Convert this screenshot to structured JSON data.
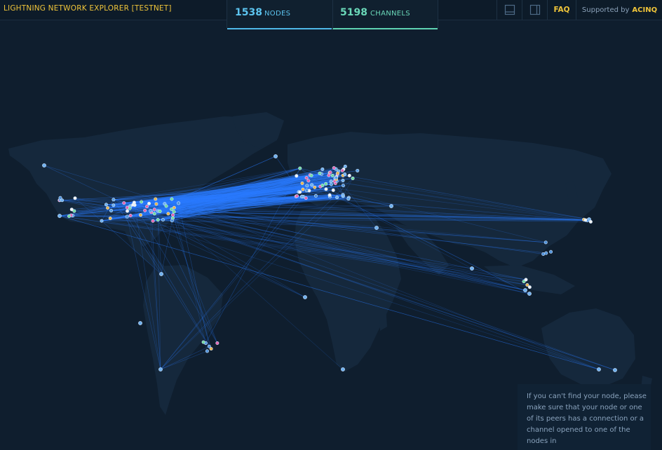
{
  "header": {
    "title": "LIGHTNING NETWORK EXPLORER [TESTNET]",
    "nodes_count": "1538",
    "nodes_label": "NODES",
    "channels_count": "5198",
    "channels_label": "CHANNELS",
    "faq_label": "FAQ",
    "supported_by": "Supported by",
    "sponsor": "ACINQ"
  },
  "info": {
    "text": "If you can't find your node, please make sure that your node or one of its peers has a connection or a channel opened to one of the nodes in"
  },
  "colors": {
    "accent_yellow": "#f0c53a",
    "nodes_blue": "#5cc4ef",
    "channels_green": "#6ad7b8",
    "edge_blue": "#2a7cff",
    "background": "#0f1e2e"
  },
  "icons": [
    "layout-horizontal-icon",
    "layout-vertical-icon"
  ]
}
